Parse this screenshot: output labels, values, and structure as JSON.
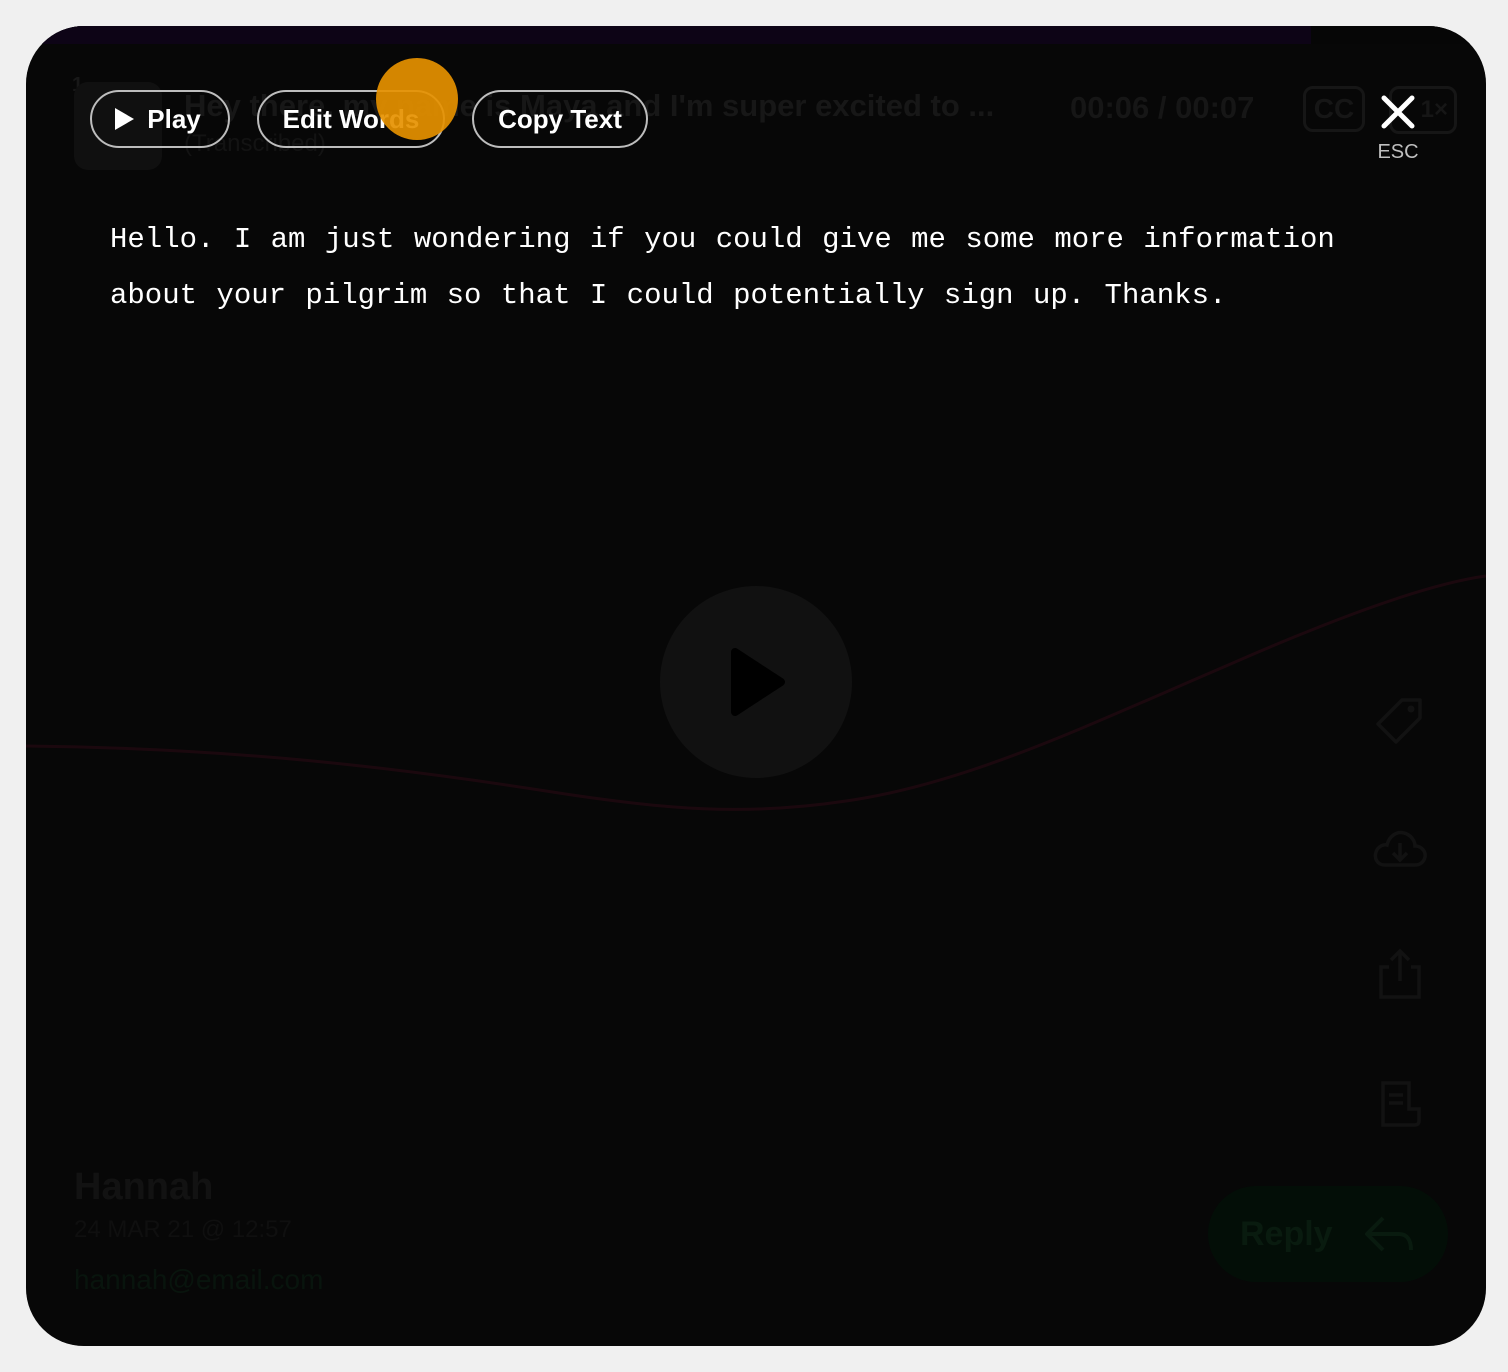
{
  "player": {
    "index": "1",
    "title": "Hey there, my name is Maya and I'm super excited to ...",
    "subtitle": "(Transcribed)",
    "time": "00:06 / 00:07",
    "cc_label": "CC",
    "speed_label": "1×",
    "progress_percent": 88
  },
  "toolbar": {
    "play_label": "Play",
    "edit_words_label": "Edit Words",
    "copy_text_label": "Copy Text"
  },
  "close": {
    "esc_label": "ESC"
  },
  "transcript": {
    "text": "Hello. I am just wondering if you could give me some more information about your pilgrim so that I could potentially sign up. Thanks."
  },
  "sender": {
    "name": "Hannah",
    "date": "24 MAR 21 @ 12:57",
    "email": "hannah@email.com"
  },
  "reply": {
    "label": "Reply"
  },
  "icons": [
    "play-icon",
    "close-icon",
    "tag-icon",
    "cloud-download-icon",
    "share-icon",
    "transcript-icon",
    "reply-arrow-icon"
  ],
  "colors": {
    "cursor": "#e69100",
    "wave": "#2a0d16",
    "reply_bg": "#06160c"
  }
}
